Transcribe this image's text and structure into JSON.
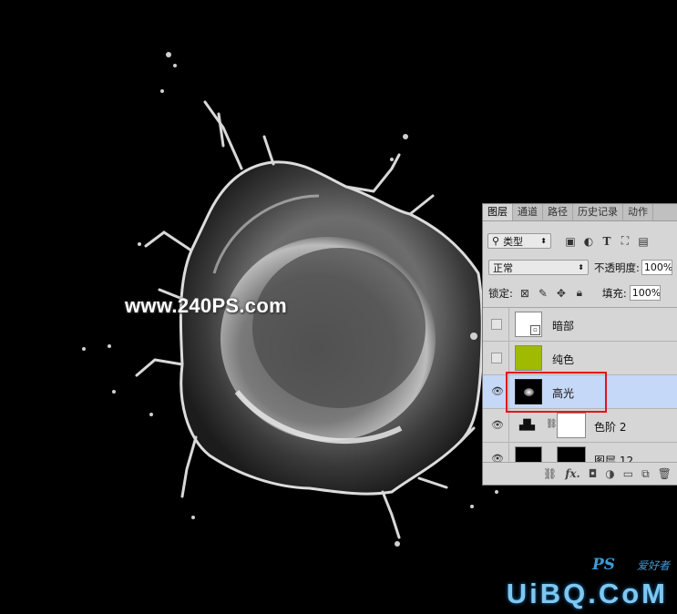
{
  "watermark": "www.240PS.com",
  "brand": {
    "ps": "PS",
    "sub": "爱好者",
    "uibq": "UiBQ.CoM"
  },
  "panel": {
    "tabs": [
      "图层",
      "通道",
      "路径",
      "历史记录",
      "动作"
    ],
    "filter": {
      "label": "类型",
      "icons": [
        "image-filter-icon",
        "adjust-filter-icon",
        "type-filter-icon",
        "shape-filter-icon",
        "smart-filter-icon"
      ]
    },
    "blend_mode": "正常",
    "opacity_label": "不透明度:",
    "opacity_value": "100%",
    "lock_label": "锁定:",
    "fill_label": "填充:",
    "fill_value": "100%",
    "layers": [
      {
        "name": "暗部",
        "visible": false,
        "thumb": "white-smart",
        "selected": false
      },
      {
        "name": "纯色",
        "visible": false,
        "thumb": "green",
        "selected": false
      },
      {
        "name": "高光",
        "visible": true,
        "thumb": "splash",
        "selected": true
      },
      {
        "name": "色阶 2",
        "visible": true,
        "thumb": "levels",
        "selected": false
      },
      {
        "name": "图层 12",
        "visible": true,
        "thumb": "splash",
        "selected": false
      }
    ],
    "footer_icons": [
      "link-icon",
      "fx-icon",
      "mask-icon",
      "adjustment-icon",
      "folder-icon",
      "new-layer-icon",
      "trash-icon"
    ],
    "footer_fx": "fx."
  },
  "colors": {
    "solid_fill": "#9fba00",
    "highlight": "#c6d8f7",
    "red": "#e3141b",
    "accent": "#3d9bd6"
  }
}
